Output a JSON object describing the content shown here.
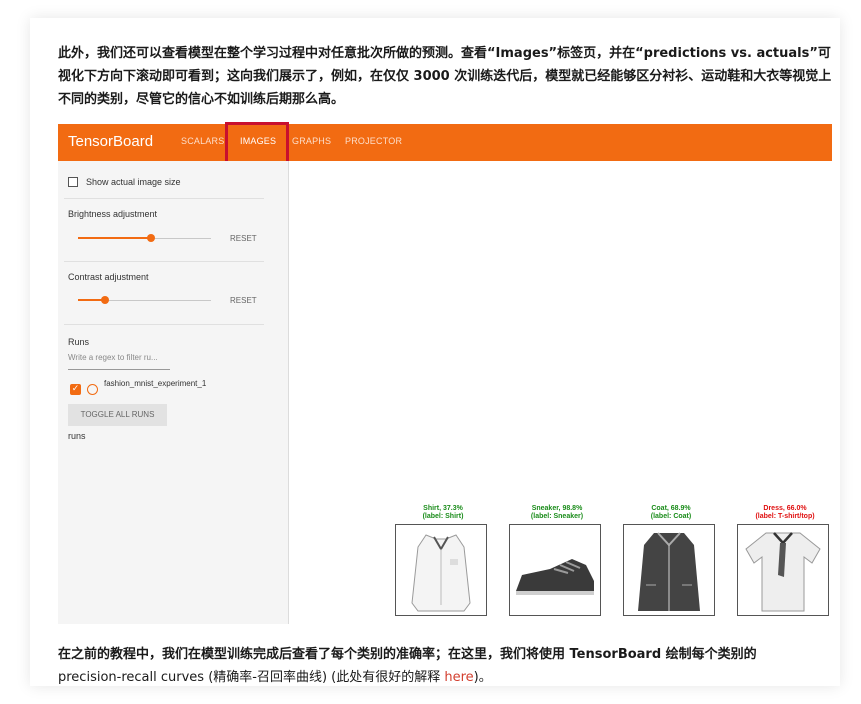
{
  "article": {
    "para1": "此外，我们还可以查看模型在整个学习过程中对任意批次所做的预测。查看“Images”标签页，并在“predictions vs. actuals”可视化下方向下滚动即可看到；这向我们展示了，例如，在仅仅 3000 次训练迭代后，模型就已经能够区分衬衫、运动鞋和大衣等视觉上不同的类别，尽管它的信心不如训练后期那么高。",
    "para2_lead": "在之前的教程中，我们在模型训练完成后查看了每个类别的准确率；在这里，我们将使用 TensorBoard 绘制每个类别的",
    "para2_rest": "precision-recall curves (精确率-召回率曲线) (此处有很好的解释 ",
    "para2_link": "here",
    "para2_end": ")。"
  },
  "tensorboard": {
    "brand": "TensorBoard",
    "tabs": [
      "SCALARS",
      "IMAGES",
      "GRAPHS",
      "PROJECTOR"
    ],
    "active_tab": "IMAGES",
    "accent_color": "#f26b12",
    "highlight_color": "#c8102e",
    "sidebar": {
      "show_actual_size": "Show actual image size",
      "brightness_label": "Brightness adjustment",
      "brightness_level": 0.55,
      "contrast_label": "Contrast adjustment",
      "contrast_level": 0.2,
      "reset": "RESET",
      "runs_label": "Runs",
      "filter_placeholder": "Write a regex to filter ru...",
      "run_name": "fashion_mnist_experiment_1",
      "toggle_all": "TOGGLE ALL RUNS",
      "runs_footer": "runs"
    },
    "predictions": [
      {
        "label": "Shirt, 37.3%",
        "actual": "(label: Shirt)",
        "correct": true,
        "icon": "shirt-image"
      },
      {
        "label": "Sneaker, 98.8%",
        "actual": "(label: Sneaker)",
        "correct": true,
        "icon": "sneaker-image"
      },
      {
        "label": "Coat, 68.9%",
        "actual": "(label: Coat)",
        "correct": true,
        "icon": "coat-image"
      },
      {
        "label": "Dress, 66.0%",
        "actual": "(label: T-shirt/top)",
        "correct": false,
        "icon": "tshirt-image"
      }
    ],
    "correct_color": "#1a8c1a",
    "wrong_color": "#e01010"
  }
}
